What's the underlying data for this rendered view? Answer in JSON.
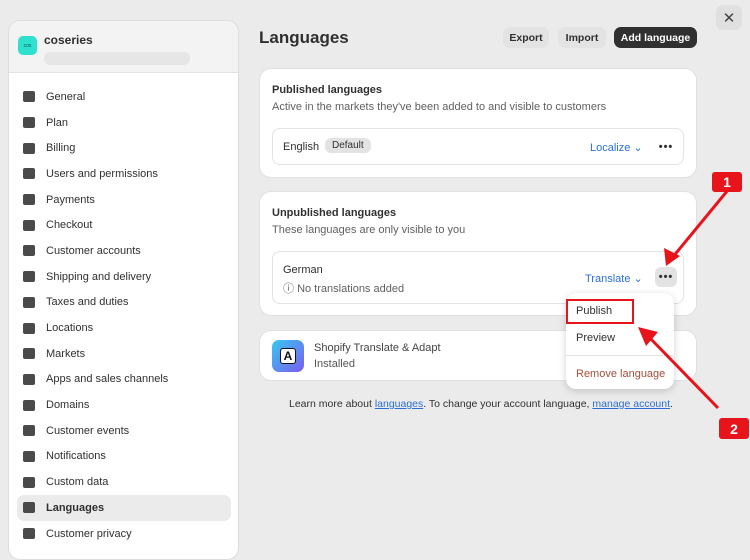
{
  "sidebar": {
    "store_name": "coseries",
    "logo_text": "cos",
    "items": [
      {
        "label": "General",
        "icon": "store-icon"
      },
      {
        "label": "Plan",
        "icon": "plan-icon"
      },
      {
        "label": "Billing",
        "icon": "billing-icon"
      },
      {
        "label": "Users and permissions",
        "icon": "users-icon"
      },
      {
        "label": "Payments",
        "icon": "payments-icon"
      },
      {
        "label": "Checkout",
        "icon": "cart-icon"
      },
      {
        "label": "Customer accounts",
        "icon": "person-icon"
      },
      {
        "label": "Shipping and delivery",
        "icon": "truck-icon"
      },
      {
        "label": "Taxes and duties",
        "icon": "tax-icon"
      },
      {
        "label": "Locations",
        "icon": "location-icon"
      },
      {
        "label": "Markets",
        "icon": "globe-icon"
      },
      {
        "label": "Apps and sales channels",
        "icon": "apps-icon"
      },
      {
        "label": "Domains",
        "icon": "domain-icon"
      },
      {
        "label": "Customer events",
        "icon": "cursor-icon"
      },
      {
        "label": "Notifications",
        "icon": "bell-icon"
      },
      {
        "label": "Custom data",
        "icon": "data-icon"
      },
      {
        "label": "Languages",
        "icon": "language-icon",
        "active": true
      },
      {
        "label": "Customer privacy",
        "icon": "lock-icon"
      }
    ]
  },
  "header": {
    "title": "Languages",
    "export": "Export",
    "import": "Import",
    "add": "Add language"
  },
  "published": {
    "title": "Published languages",
    "subtitle": "Active in the markets they've been added to and visible to customers",
    "language": "English",
    "badge": "Default",
    "action": "Localize"
  },
  "unpublished": {
    "title": "Unpublished languages",
    "subtitle": "These languages are only visible to you",
    "language": "German",
    "status": "No translations added",
    "action": "Translate"
  },
  "app": {
    "name": "Shopify Translate & Adapt",
    "status": "Installed"
  },
  "footer": {
    "pre": "Learn more about ",
    "link1": "languages",
    "mid": ". To change your account language, ",
    "link2": "manage account",
    "post": "."
  },
  "menu": {
    "items": [
      "Publish",
      "Preview",
      "Remove language"
    ]
  },
  "annotations": [
    "1",
    "2"
  ],
  "colors": {
    "accent": "#2b6fd6",
    "danger": "#8e1f0b",
    "annotation": "#e8141b"
  }
}
